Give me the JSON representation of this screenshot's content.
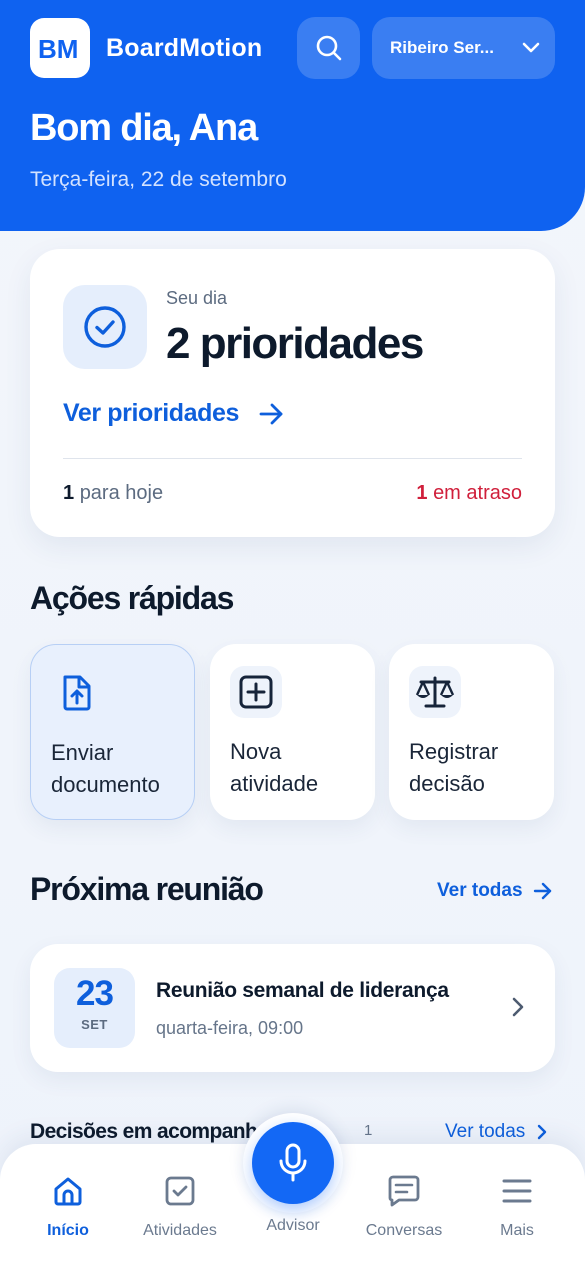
{
  "app": {
    "brand": "BoardMotion",
    "logo_text": "BM"
  },
  "header": {
    "org_selector": "Ribeiro Ser...",
    "greeting": "Bom dia, Ana",
    "date": "Terça-feira, 22 de setembro"
  },
  "priorities": {
    "kicker": "Seu dia",
    "title": "2 prioridades",
    "link": "Ver prioridades",
    "today_count": "1",
    "today_label": "para hoje",
    "late_count": "1",
    "late_label": "em atraso"
  },
  "quick_actions": {
    "title": "Ações rápidas",
    "items": [
      {
        "label": "Enviar documento",
        "icon": "upload-file-icon"
      },
      {
        "label": "Nova atividade",
        "icon": "plus-square-icon"
      },
      {
        "label": "Registrar decisão",
        "icon": "scale-icon"
      }
    ]
  },
  "next_meeting": {
    "title": "Próxima reunião",
    "see_all": "Ver todas",
    "day": "23",
    "month": "SET",
    "meeting_title": "Reunião semanal de liderança",
    "meeting_time": "quarta-feira, 09:00"
  },
  "decisions": {
    "title": "Decisões em acompanhamento",
    "count": "1",
    "see_all": "Ver todas"
  },
  "bottom_nav": {
    "items": [
      {
        "label": "Início",
        "icon": "home-icon"
      },
      {
        "label": "Atividades",
        "icon": "checkbox-icon"
      },
      {
        "label": "Advisor",
        "icon": "microphone-icon"
      },
      {
        "label": "Conversas",
        "icon": "chat-icon"
      },
      {
        "label": "Mais",
        "icon": "menu-icon"
      }
    ]
  },
  "colors": {
    "primary": "#0f62f0",
    "accent": "#0e5fdc",
    "danger": "#d01f3b"
  }
}
